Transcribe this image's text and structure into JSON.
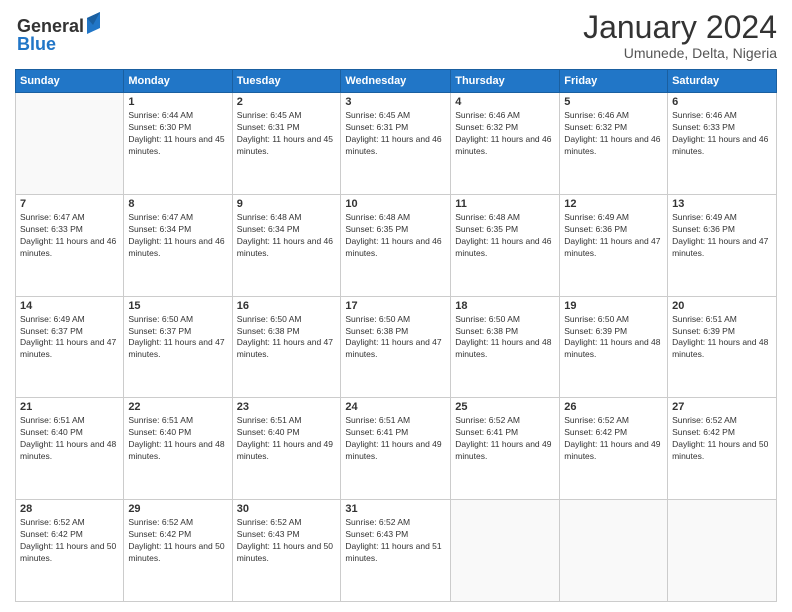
{
  "logo": {
    "line1": "General",
    "line2": "Blue"
  },
  "title": "January 2024",
  "subtitle": "Umunede, Delta, Nigeria",
  "days_of_week": [
    "Sunday",
    "Monday",
    "Tuesday",
    "Wednesday",
    "Thursday",
    "Friday",
    "Saturday"
  ],
  "weeks": [
    [
      {
        "day": "",
        "sunrise": "",
        "sunset": "",
        "daylight": ""
      },
      {
        "day": "1",
        "sunrise": "Sunrise: 6:44 AM",
        "sunset": "Sunset: 6:30 PM",
        "daylight": "Daylight: 11 hours and 45 minutes."
      },
      {
        "day": "2",
        "sunrise": "Sunrise: 6:45 AM",
        "sunset": "Sunset: 6:31 PM",
        "daylight": "Daylight: 11 hours and 45 minutes."
      },
      {
        "day": "3",
        "sunrise": "Sunrise: 6:45 AM",
        "sunset": "Sunset: 6:31 PM",
        "daylight": "Daylight: 11 hours and 46 minutes."
      },
      {
        "day": "4",
        "sunrise": "Sunrise: 6:46 AM",
        "sunset": "Sunset: 6:32 PM",
        "daylight": "Daylight: 11 hours and 46 minutes."
      },
      {
        "day": "5",
        "sunrise": "Sunrise: 6:46 AM",
        "sunset": "Sunset: 6:32 PM",
        "daylight": "Daylight: 11 hours and 46 minutes."
      },
      {
        "day": "6",
        "sunrise": "Sunrise: 6:46 AM",
        "sunset": "Sunset: 6:33 PM",
        "daylight": "Daylight: 11 hours and 46 minutes."
      }
    ],
    [
      {
        "day": "7",
        "sunrise": "Sunrise: 6:47 AM",
        "sunset": "Sunset: 6:33 PM",
        "daylight": "Daylight: 11 hours and 46 minutes."
      },
      {
        "day": "8",
        "sunrise": "Sunrise: 6:47 AM",
        "sunset": "Sunset: 6:34 PM",
        "daylight": "Daylight: 11 hours and 46 minutes."
      },
      {
        "day": "9",
        "sunrise": "Sunrise: 6:48 AM",
        "sunset": "Sunset: 6:34 PM",
        "daylight": "Daylight: 11 hours and 46 minutes."
      },
      {
        "day": "10",
        "sunrise": "Sunrise: 6:48 AM",
        "sunset": "Sunset: 6:35 PM",
        "daylight": "Daylight: 11 hours and 46 minutes."
      },
      {
        "day": "11",
        "sunrise": "Sunrise: 6:48 AM",
        "sunset": "Sunset: 6:35 PM",
        "daylight": "Daylight: 11 hours and 46 minutes."
      },
      {
        "day": "12",
        "sunrise": "Sunrise: 6:49 AM",
        "sunset": "Sunset: 6:36 PM",
        "daylight": "Daylight: 11 hours and 47 minutes."
      },
      {
        "day": "13",
        "sunrise": "Sunrise: 6:49 AM",
        "sunset": "Sunset: 6:36 PM",
        "daylight": "Daylight: 11 hours and 47 minutes."
      }
    ],
    [
      {
        "day": "14",
        "sunrise": "Sunrise: 6:49 AM",
        "sunset": "Sunset: 6:37 PM",
        "daylight": "Daylight: 11 hours and 47 minutes."
      },
      {
        "day": "15",
        "sunrise": "Sunrise: 6:50 AM",
        "sunset": "Sunset: 6:37 PM",
        "daylight": "Daylight: 11 hours and 47 minutes."
      },
      {
        "day": "16",
        "sunrise": "Sunrise: 6:50 AM",
        "sunset": "Sunset: 6:38 PM",
        "daylight": "Daylight: 11 hours and 47 minutes."
      },
      {
        "day": "17",
        "sunrise": "Sunrise: 6:50 AM",
        "sunset": "Sunset: 6:38 PM",
        "daylight": "Daylight: 11 hours and 47 minutes."
      },
      {
        "day": "18",
        "sunrise": "Sunrise: 6:50 AM",
        "sunset": "Sunset: 6:38 PM",
        "daylight": "Daylight: 11 hours and 48 minutes."
      },
      {
        "day": "19",
        "sunrise": "Sunrise: 6:50 AM",
        "sunset": "Sunset: 6:39 PM",
        "daylight": "Daylight: 11 hours and 48 minutes."
      },
      {
        "day": "20",
        "sunrise": "Sunrise: 6:51 AM",
        "sunset": "Sunset: 6:39 PM",
        "daylight": "Daylight: 11 hours and 48 minutes."
      }
    ],
    [
      {
        "day": "21",
        "sunrise": "Sunrise: 6:51 AM",
        "sunset": "Sunset: 6:40 PM",
        "daylight": "Daylight: 11 hours and 48 minutes."
      },
      {
        "day": "22",
        "sunrise": "Sunrise: 6:51 AM",
        "sunset": "Sunset: 6:40 PM",
        "daylight": "Daylight: 11 hours and 48 minutes."
      },
      {
        "day": "23",
        "sunrise": "Sunrise: 6:51 AM",
        "sunset": "Sunset: 6:40 PM",
        "daylight": "Daylight: 11 hours and 49 minutes."
      },
      {
        "day": "24",
        "sunrise": "Sunrise: 6:51 AM",
        "sunset": "Sunset: 6:41 PM",
        "daylight": "Daylight: 11 hours and 49 minutes."
      },
      {
        "day": "25",
        "sunrise": "Sunrise: 6:52 AM",
        "sunset": "Sunset: 6:41 PM",
        "daylight": "Daylight: 11 hours and 49 minutes."
      },
      {
        "day": "26",
        "sunrise": "Sunrise: 6:52 AM",
        "sunset": "Sunset: 6:42 PM",
        "daylight": "Daylight: 11 hours and 49 minutes."
      },
      {
        "day": "27",
        "sunrise": "Sunrise: 6:52 AM",
        "sunset": "Sunset: 6:42 PM",
        "daylight": "Daylight: 11 hours and 50 minutes."
      }
    ],
    [
      {
        "day": "28",
        "sunrise": "Sunrise: 6:52 AM",
        "sunset": "Sunset: 6:42 PM",
        "daylight": "Daylight: 11 hours and 50 minutes."
      },
      {
        "day": "29",
        "sunrise": "Sunrise: 6:52 AM",
        "sunset": "Sunset: 6:42 PM",
        "daylight": "Daylight: 11 hours and 50 minutes."
      },
      {
        "day": "30",
        "sunrise": "Sunrise: 6:52 AM",
        "sunset": "Sunset: 6:43 PM",
        "daylight": "Daylight: 11 hours and 50 minutes."
      },
      {
        "day": "31",
        "sunrise": "Sunrise: 6:52 AM",
        "sunset": "Sunset: 6:43 PM",
        "daylight": "Daylight: 11 hours and 51 minutes."
      },
      {
        "day": "",
        "sunrise": "",
        "sunset": "",
        "daylight": ""
      },
      {
        "day": "",
        "sunrise": "",
        "sunset": "",
        "daylight": ""
      },
      {
        "day": "",
        "sunrise": "",
        "sunset": "",
        "daylight": ""
      }
    ]
  ]
}
